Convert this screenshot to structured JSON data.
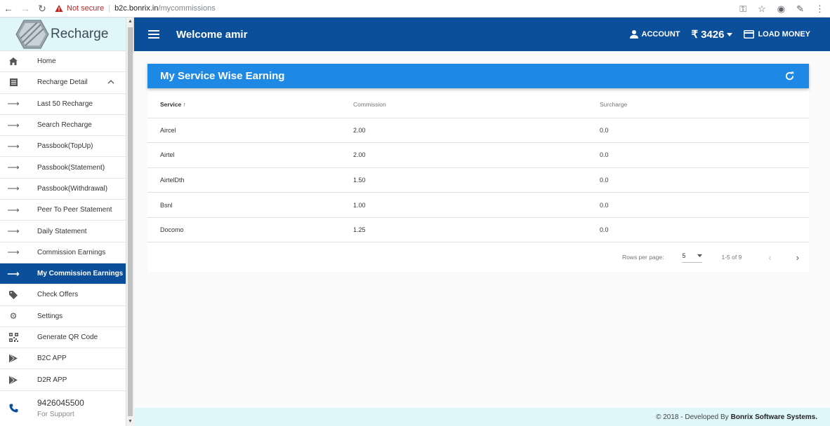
{
  "browser": {
    "not_secure": "Not secure",
    "url_host": "b2c.bonrix.in",
    "url_path": "/mycommissions"
  },
  "brand": {
    "name": "Recharge"
  },
  "sidebar": {
    "items": [
      {
        "label": "Home",
        "icon": "home-icon"
      },
      {
        "label": "Recharge Detail",
        "icon": "list-icon"
      },
      {
        "label": "Last 50 Recharge",
        "icon": "arrow-right-icon"
      },
      {
        "label": "Search Recharge",
        "icon": "arrow-right-icon"
      },
      {
        "label": "Passbook(TopUp)",
        "icon": "arrow-right-icon"
      },
      {
        "label": "Passbook(Statement)",
        "icon": "arrow-right-icon"
      },
      {
        "label": "Passbook(Withdrawal)",
        "icon": "arrow-right-icon"
      },
      {
        "label": "Peer To Peer Statement",
        "icon": "arrow-right-icon"
      },
      {
        "label": "Daily Statement",
        "icon": "arrow-right-icon"
      },
      {
        "label": "Commission Earnings",
        "icon": "arrow-right-icon"
      },
      {
        "label": "My Commission Earnings",
        "icon": "arrow-right-icon"
      },
      {
        "label": "Check Offers",
        "icon": "tag-icon"
      },
      {
        "label": "Settings",
        "icon": "gear-icon"
      },
      {
        "label": "Generate QR Code",
        "icon": "qr-code-icon"
      },
      {
        "label": "B2C APP",
        "icon": "play-store-icon"
      },
      {
        "label": "D2R APP",
        "icon": "play-store-icon"
      }
    ],
    "support_phone": "9426045500",
    "support_label": "For Support"
  },
  "header": {
    "welcome": "Welcome amir",
    "account": "ACCOUNT",
    "currency": "₹",
    "balance": "3426",
    "load_money": "LOAD MONEY"
  },
  "card": {
    "title": "My Service Wise Earning",
    "columns": [
      "Service",
      "Commission",
      "Surcharge"
    ],
    "rows": [
      [
        "Aircel",
        "2.00",
        "0.0"
      ],
      [
        "Airtel",
        "2.00",
        "0.0"
      ],
      [
        "AirtelDth",
        "1.50",
        "0.0"
      ],
      [
        "Bsnl",
        "1.00",
        "0.0"
      ],
      [
        "Docomo",
        "1.25",
        "0.0"
      ]
    ],
    "rows_per_page_label": "Rows per page:",
    "rows_per_page": "5",
    "range": "1-5 of 9"
  },
  "footer": {
    "text": "© 2018 - Developed By",
    "company": "Bonrix Software Systems."
  },
  "colors": {
    "primary": "#0b4f9a",
    "card_header": "#1e88e5",
    "brand_bg": "#e0f7fa"
  }
}
